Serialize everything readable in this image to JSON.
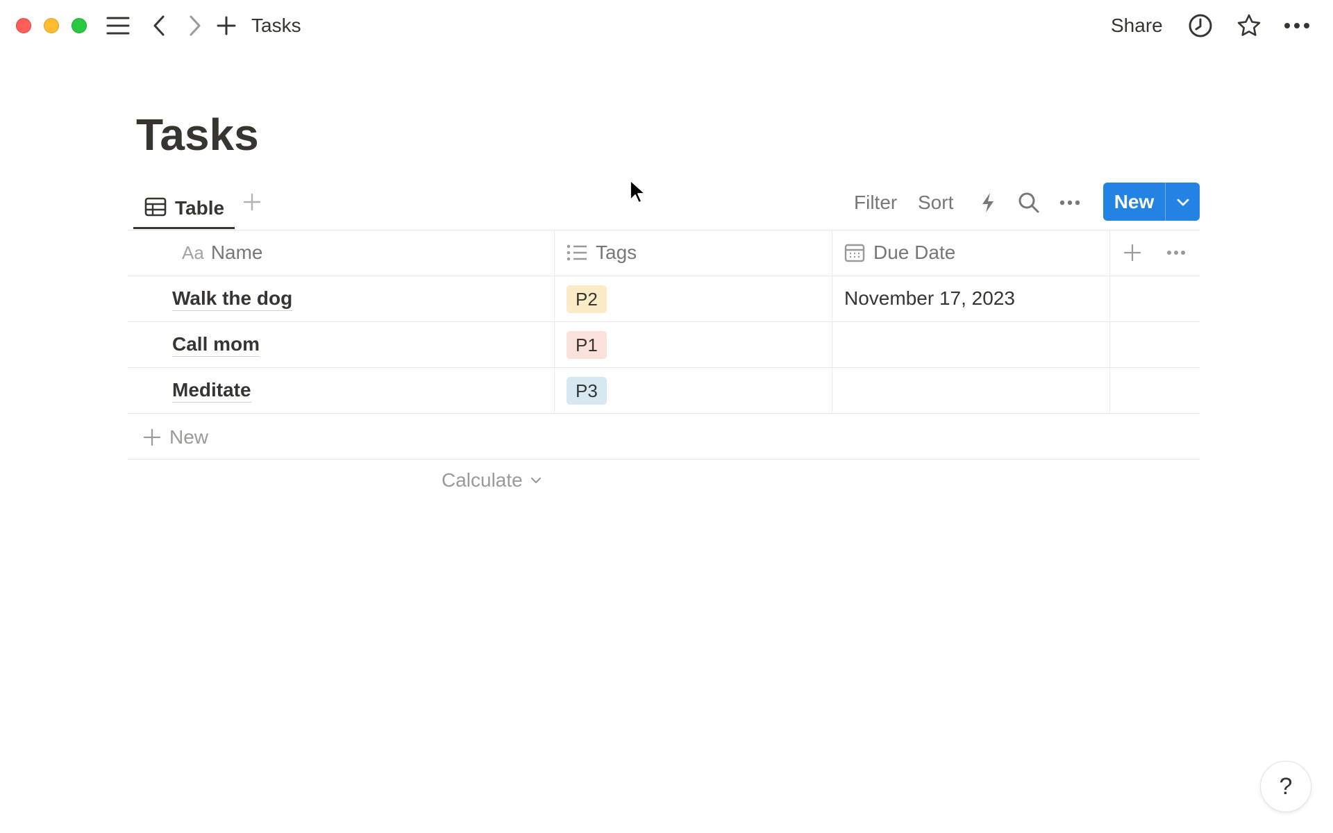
{
  "window": {
    "breadcrumb": "Tasks",
    "share_label": "Share"
  },
  "page": {
    "title": "Tasks"
  },
  "view_bar": {
    "active_view_label": "Table",
    "filter_label": "Filter",
    "sort_label": "Sort",
    "new_label": "New"
  },
  "table": {
    "columns": [
      {
        "icon": "Aa",
        "label": "Name"
      },
      {
        "icon": "list-icon",
        "label": "Tags"
      },
      {
        "icon": "calendar-icon",
        "label": "Due Date"
      }
    ],
    "rows": [
      {
        "name": "Walk the dog",
        "tag": "P2",
        "tag_color": "#fbecc7",
        "due": "November 17, 2023"
      },
      {
        "name": "Call mom",
        "tag": "P1",
        "tag_color": "#fbe1dc",
        "due": ""
      },
      {
        "name": "Meditate",
        "tag": "P3",
        "tag_color": "#d8e8f3",
        "due": ""
      }
    ],
    "new_row_label": "New",
    "calculate_label": "Calculate"
  },
  "help_label": "?",
  "colors": {
    "accent": "#2383e2",
    "text": "#37352f",
    "muted": "#787774"
  }
}
